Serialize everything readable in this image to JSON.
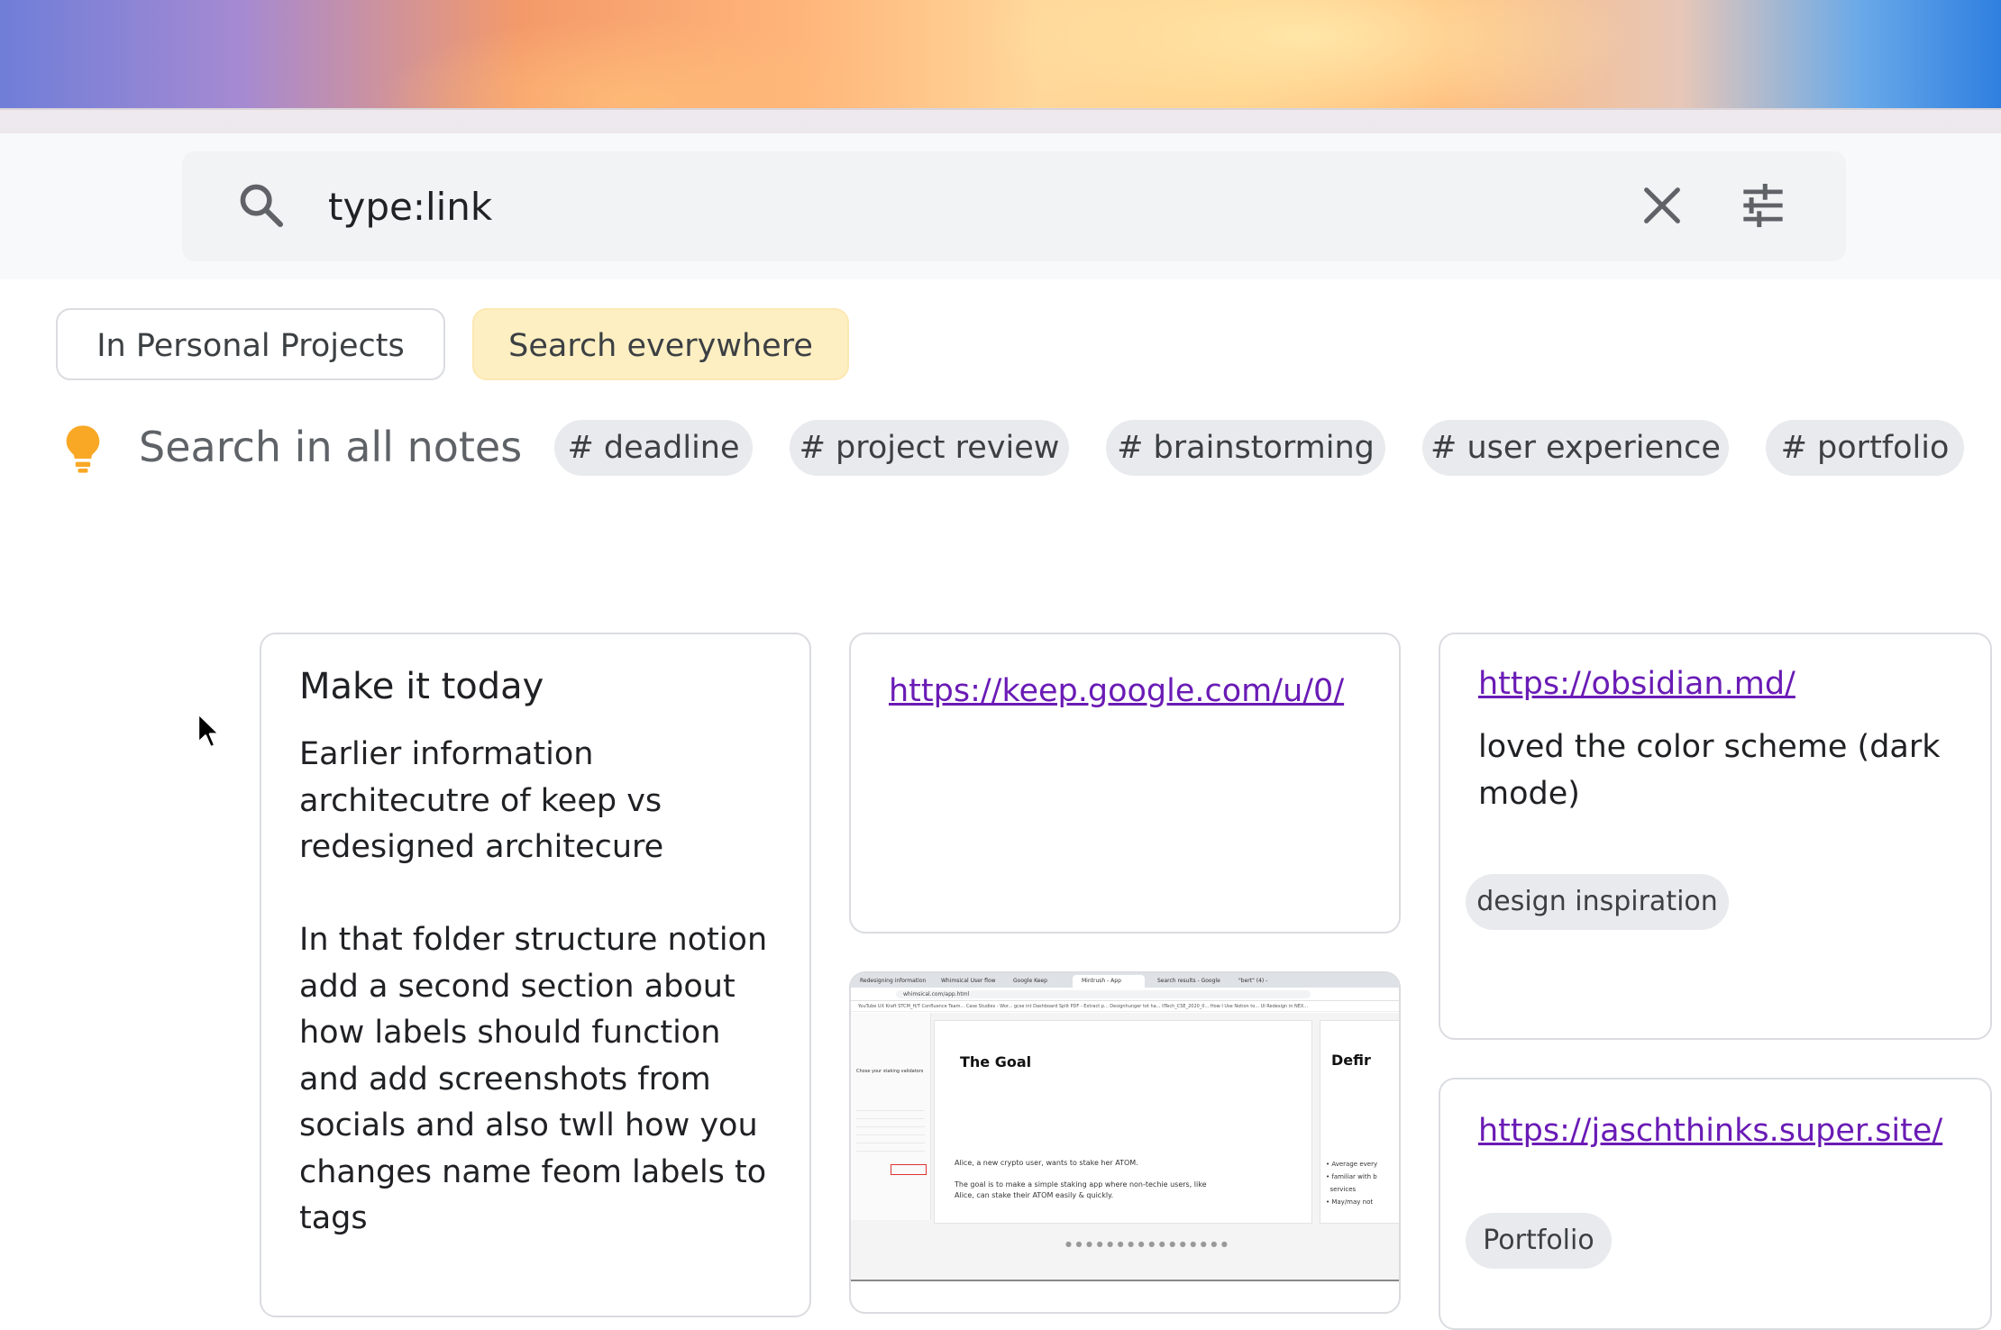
{
  "search": {
    "query": "type:link"
  },
  "scope_chips": [
    {
      "label": "In Personal Projects",
      "selected": false
    },
    {
      "label": "Search everywhere",
      "selected": true
    }
  ],
  "suggestions": {
    "label": "Search in all notes",
    "tags": [
      "# deadline",
      "# project review",
      "# brainstorming",
      "# user experience",
      "# portfolio"
    ]
  },
  "notes": {
    "note1": {
      "title": "Make it today",
      "body": "Earlier information architecutre of keep vs redesigned architecure\n\nIn that folder structure notion add a second section about how labels should function and add screenshots from socials and also twll how you changes name feom labels to tags"
    },
    "note2": {
      "link": "https://keep.google.com/u/0/"
    },
    "note3": {
      "image": {
        "tab_labels": [
          "Redesigning information a...",
          "Whimsical User flow",
          "Google Keep",
          "Mintrush - App",
          "Search results - Google D...",
          "\"bert\" (4) - mjsch@mailbox..."
        ],
        "url": "whimsical.com/app.html",
        "bookmarks": "YouTube   UX Kraft   STCM_H/T   Confluence Team...   Case Studies - Wor...   gcse int   Dashboard   Split PDF - Extract p...   Designhunger tot ha...   IITech_CSE_2020_0...   How I Use Notion to...   UI Redesign in NEX...",
        "slide1_heading": "The Goal",
        "slide1_p1": "Alice, a new crypto user, wants to stake her ATOM.",
        "slide1_p2": "The goal is to make a simple staking app where non-techie users, like Alice, can stake their ATOM easily & quickly.",
        "slide2_heading": "Defir",
        "slide2_bullets": "• Average every\n• familiar with b\n  services\n• May/may not",
        "side_heading": "Chose your staking validators",
        "page_dots": "● ● ● ● ● ● ● ● ● ● ● ● ● ● ● ●"
      }
    },
    "note4": {
      "link": "https://obsidian.md/",
      "text": "loved the color scheme (dark mode)",
      "label": "design inspiration"
    },
    "note5": {
      "link": "https://jaschthinks.super.site/",
      "label": "Portfolio"
    }
  },
  "colors": {
    "chip_selected": "#feefc3",
    "link": "#6a1bb5",
    "bulb": "#f9a825",
    "tag_bg": "#e8eaed"
  },
  "icons": [
    "search-icon",
    "close-icon",
    "tune-icon",
    "lightbulb-icon",
    "mouse-cursor-icon"
  ]
}
